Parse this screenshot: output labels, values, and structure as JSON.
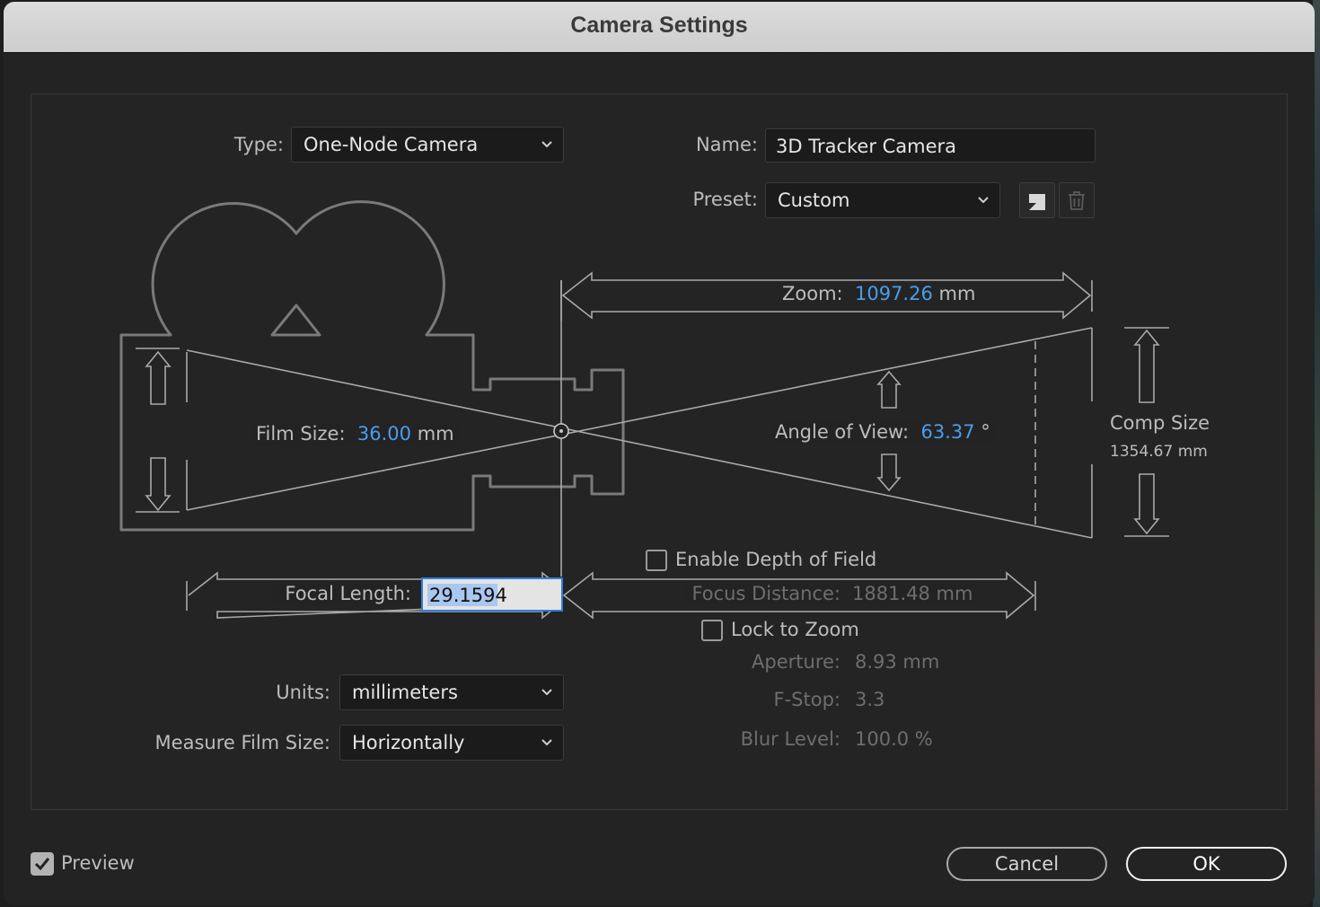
{
  "dialog": {
    "title": "Camera Settings"
  },
  "type": {
    "label": "Type:",
    "value": "One-Node Camera"
  },
  "name": {
    "label": "Name:",
    "value": "3D Tracker Camera"
  },
  "preset": {
    "label": "Preset:",
    "value": "Custom",
    "save_icon": "save-preset-icon",
    "delete_icon": "trash-icon"
  },
  "zoom": {
    "label": "Zoom:",
    "value": "1097.26",
    "unit": "mm"
  },
  "film_size": {
    "label": "Film Size:",
    "value": "36.00",
    "unit": "mm"
  },
  "angle_of_view": {
    "label": "Angle of View:",
    "value": "63.37",
    "unit": "°"
  },
  "comp_size": {
    "label": "Comp Size",
    "value": "1354.67 mm"
  },
  "depth_of_field": {
    "label": "Enable Depth of Field",
    "checked": false
  },
  "focal_length": {
    "label": "Focal Length:",
    "value": "29.1594"
  },
  "focus_distance": {
    "label": "Focus Distance:",
    "value": "1881.48 mm"
  },
  "lock_to_zoom": {
    "label": "Lock to Zoom",
    "checked": false
  },
  "aperture": {
    "label": "Aperture:",
    "value": "8.93 mm"
  },
  "fstop": {
    "label": "F-Stop:",
    "value": "3.3"
  },
  "blur_level": {
    "label": "Blur Level:",
    "value": "100.0 %"
  },
  "units": {
    "label": "Units:",
    "value": "millimeters"
  },
  "measure_film_size": {
    "label": "Measure Film Size:",
    "value": "Horizontally"
  },
  "preview": {
    "label": "Preview",
    "checked": true
  },
  "buttons": {
    "cancel": "Cancel",
    "ok": "OK"
  },
  "colors": {
    "accent": "#4a9ded",
    "focus_ring": "#2f7de0",
    "background": "#232323",
    "title_bar": "#d4d4d4"
  }
}
